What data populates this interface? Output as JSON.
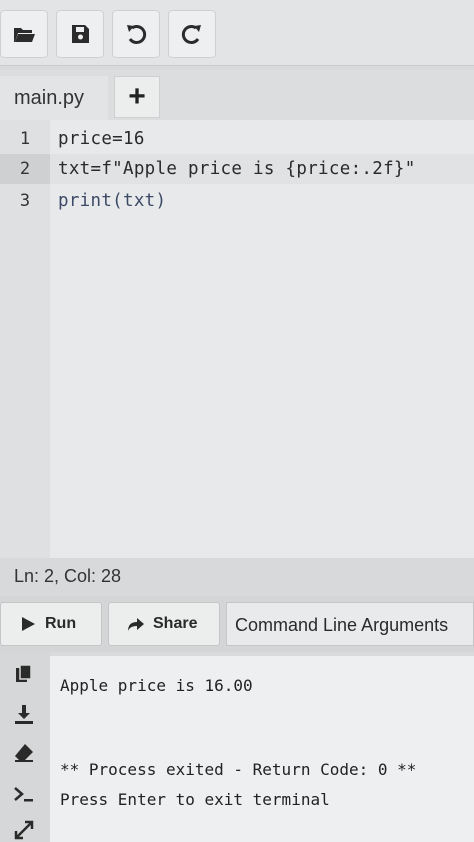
{
  "toolbar": {
    "buttons": [
      "open-folder-icon",
      "save-icon",
      "undo-icon",
      "redo-icon"
    ]
  },
  "tabs": {
    "active_file": "main.py",
    "add_label": "+"
  },
  "editor": {
    "lines": [
      {
        "no": "1",
        "code": "price=16"
      },
      {
        "no": "2",
        "code": "txt=f\"Apple price is {price:.2f}\""
      },
      {
        "no": "3",
        "code": "print(txt)"
      }
    ]
  },
  "status": {
    "position": "Ln: 2,  Col: 28"
  },
  "actions": {
    "run_label": "Run",
    "share_label": "Share",
    "args_label": "Command Line Arguments"
  },
  "terminal": {
    "output": "Apple price is 16.00",
    "exit_message": "** Process exited - Return Code: 0 **",
    "prompt": "Press Enter to exit terminal"
  }
}
